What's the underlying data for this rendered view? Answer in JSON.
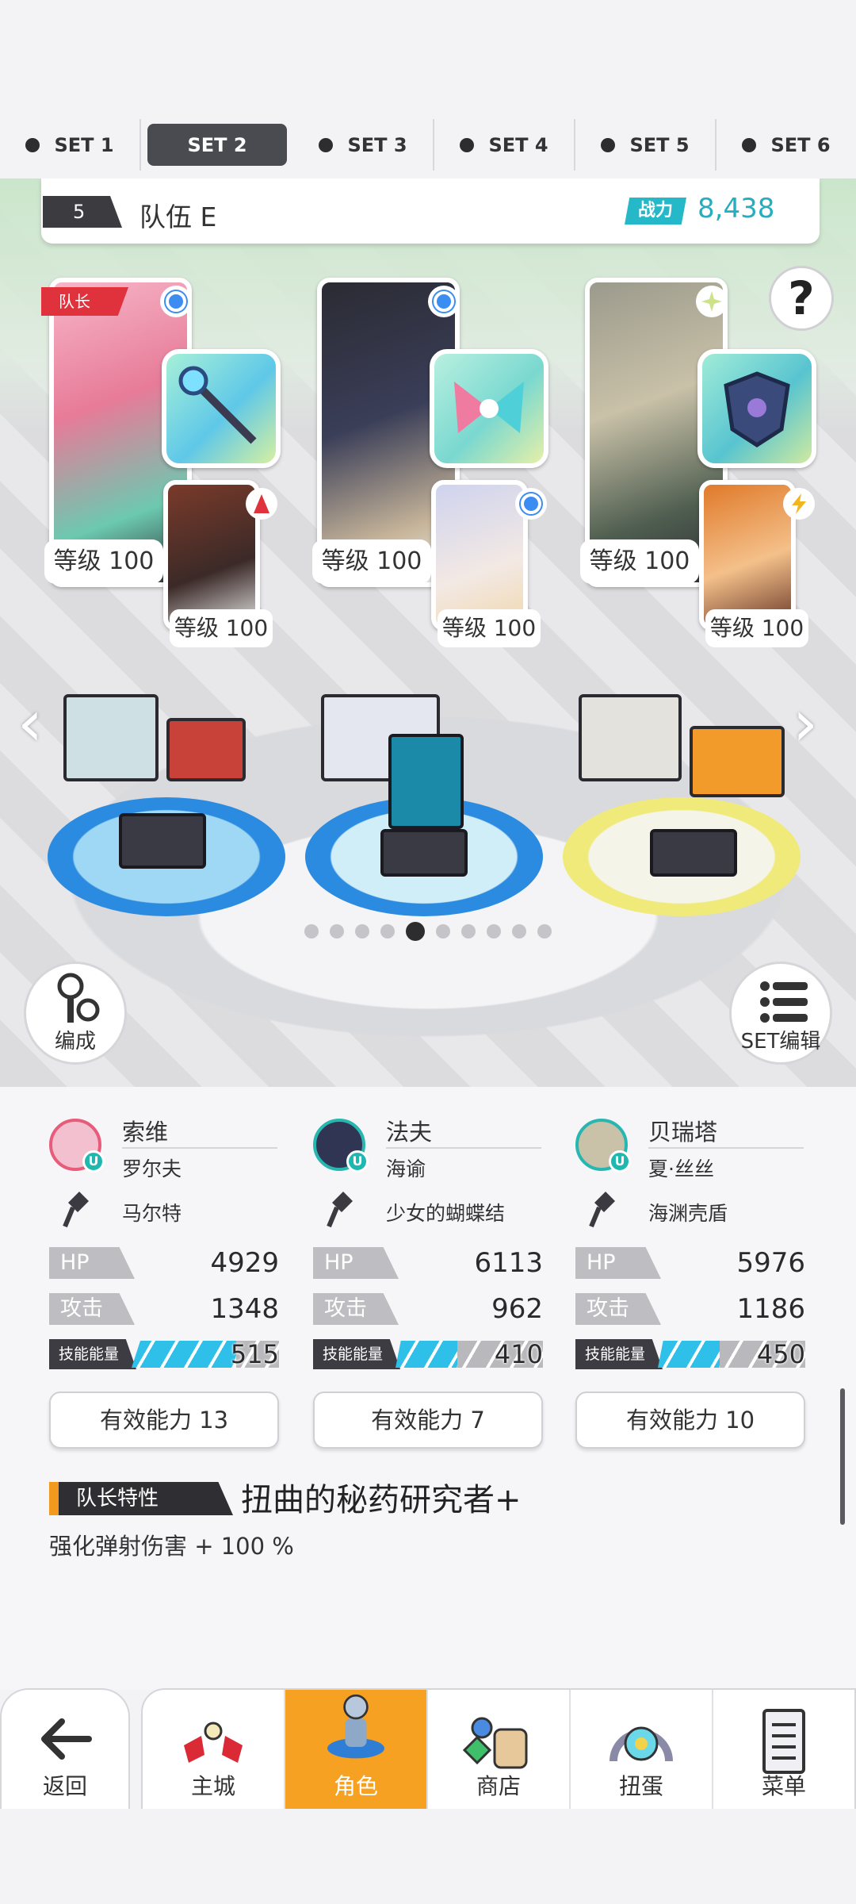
{
  "tabs": [
    {
      "label": "SET 1",
      "active": false
    },
    {
      "label": "SET 2",
      "active": true
    },
    {
      "label": "SET 3",
      "active": false
    },
    {
      "label": "SET 4",
      "active": false
    },
    {
      "label": "SET 5",
      "active": false
    },
    {
      "label": "SET 6",
      "active": false
    }
  ],
  "team": {
    "number": "5",
    "name": "队伍 E",
    "power_label": "战力",
    "power_value": "8,438"
  },
  "help": {
    "symbol": "?"
  },
  "leader_tag": "队长",
  "cards": [
    {
      "main_level": "等级 100",
      "sub_level": "等级 100"
    },
    {
      "main_level": "等级 100",
      "sub_level": "等级 100"
    },
    {
      "main_level": "等级 100",
      "sub_level": "等级 100"
    }
  ],
  "nav_arrows": {
    "left": "‹",
    "right": "›"
  },
  "buttons": {
    "formation": "编成",
    "set_edit": "SET编辑"
  },
  "pagination": {
    "count": 10,
    "active": 4
  },
  "characters": [
    {
      "name": "索维",
      "sub": "罗尔夫",
      "weapon": "马尔特",
      "hp_label": "HP",
      "hp": "4929",
      "atk_label": "攻击",
      "atk": "1348",
      "energy_label": "技能能量",
      "energy": "515",
      "energy_fill": 0.74,
      "ability": "有效能力 13"
    },
    {
      "name": "法夫",
      "sub": "海谕",
      "weapon": "少女的蝴蝶结",
      "hp_label": "HP",
      "hp": "6113",
      "atk_label": "攻击",
      "atk": "962",
      "energy_label": "技能能量",
      "energy": "410",
      "energy_fill": 0.45,
      "ability": "有效能力 7"
    },
    {
      "name": "贝瑞塔",
      "sub": "夏·丝丝",
      "weapon": "海渊壳盾",
      "hp_label": "HP",
      "hp": "5976",
      "atk_label": "攻击",
      "atk": "1186",
      "energy_label": "技能能量",
      "energy": "450",
      "energy_fill": 0.45,
      "ability": "有效能力 10"
    }
  ],
  "leader_trait": {
    "label": "队长特性",
    "name": "扭曲的秘药研究者+",
    "desc": "强化弹射伤害 + 100 %"
  },
  "bottom_nav": {
    "back": "返回",
    "items": [
      {
        "label": "主城",
        "icon": "castle-icon",
        "active": false
      },
      {
        "label": "角色",
        "icon": "character-icon",
        "active": true
      },
      {
        "label": "商店",
        "icon": "shop-icon",
        "active": false
      },
      {
        "label": "扭蛋",
        "icon": "gacha-icon",
        "active": false
      },
      {
        "label": "菜单",
        "icon": "menu-icon",
        "active": false
      }
    ]
  },
  "colors": {
    "accent_orange": "#f7a122",
    "power_teal": "#24b8c8",
    "leader_red": "#e0323d",
    "energy_blue": "#2ec0e8"
  }
}
